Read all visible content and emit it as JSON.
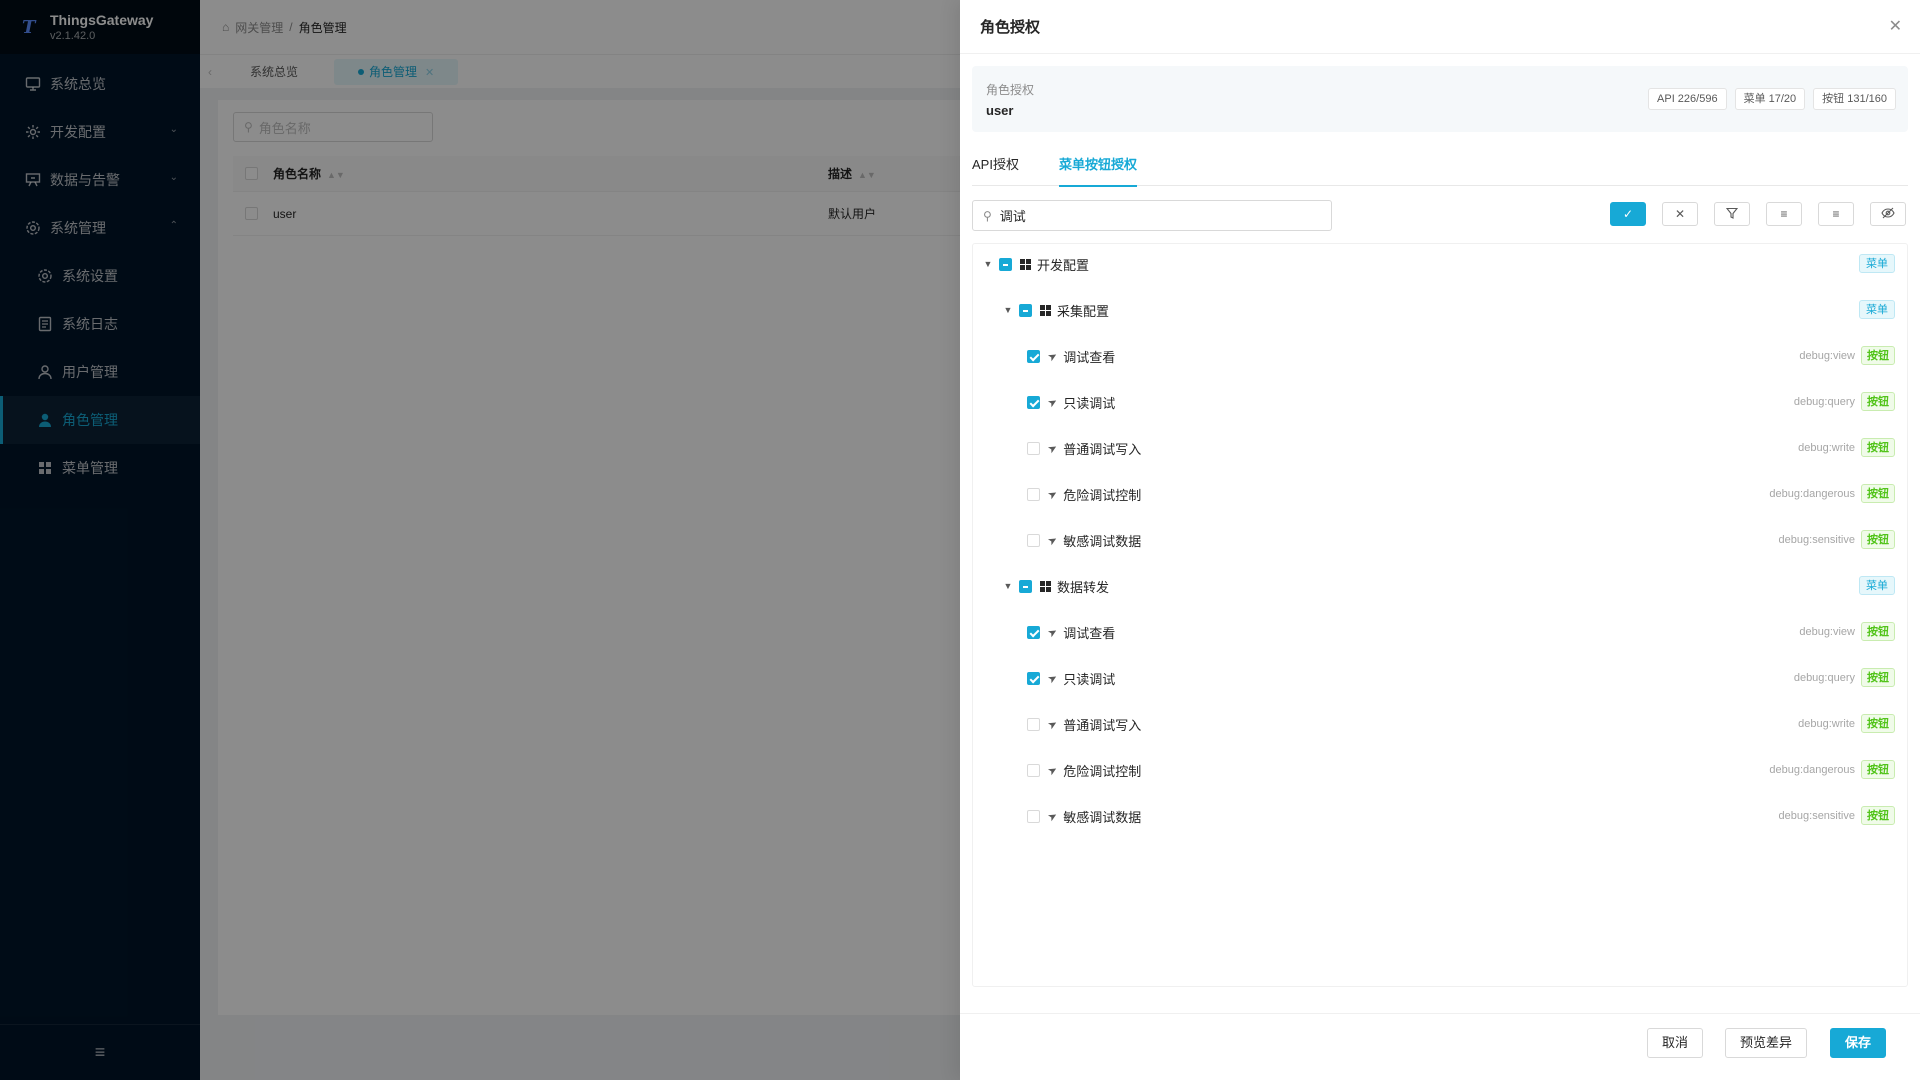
{
  "app": {
    "name": "ThingsGateway",
    "version": "v2.1.42.0"
  },
  "sidebar": {
    "items": [
      {
        "label": "系统总览",
        "icon": "monitor-icon"
      },
      {
        "label": "开发配置",
        "icon": "gear-icon"
      },
      {
        "label": "数据与告警",
        "icon": "projector-icon"
      },
      {
        "label": "系统管理",
        "icon": "settings-icon"
      },
      {
        "label": "系统设置",
        "icon": "settings-icon"
      },
      {
        "label": "系统日志",
        "icon": "document-icon"
      },
      {
        "label": "用户管理",
        "icon": "user-icon"
      },
      {
        "label": "角色管理",
        "icon": "user-filled-icon"
      },
      {
        "label": "菜单管理",
        "icon": "grid-icon"
      }
    ]
  },
  "header": {
    "breadcrumb": [
      "网关管理",
      "角色管理"
    ]
  },
  "tabs": [
    {
      "label": "系统总览"
    },
    {
      "label": "角色管理"
    }
  ],
  "list": {
    "search_placeholder": "角色名称",
    "columns": {
      "name": "角色名称",
      "desc": "描述"
    },
    "rows": [
      {
        "name": "user",
        "desc": "默认用户"
      }
    ]
  },
  "drawer": {
    "title": "角色授权",
    "info_label": "角色授权",
    "role_name": "user",
    "stats": {
      "api": "API 226/596",
      "menu": "菜单 17/20",
      "button": "按钮 131/160"
    },
    "tabs": {
      "api": "API授权",
      "menu_button": "菜单按钮授权"
    },
    "search_value": "调试",
    "badge_menu": "菜单",
    "badge_button": "按钮",
    "tree": [
      {
        "label": "开发配置",
        "type": "menu",
        "state": "indeterminate",
        "level": 0
      },
      {
        "label": "采集配置",
        "type": "menu",
        "state": "indeterminate",
        "level": 1
      },
      {
        "label": "调试查看",
        "type": "button",
        "state": "checked",
        "code": "debug:view",
        "level": 2
      },
      {
        "label": "只读调试",
        "type": "button",
        "state": "checked",
        "code": "debug:query",
        "level": 2
      },
      {
        "label": "普通调试写入",
        "type": "button",
        "state": "unchecked",
        "code": "debug:write",
        "level": 2
      },
      {
        "label": "危险调试控制",
        "type": "button",
        "state": "unchecked",
        "code": "debug:dangerous",
        "level": 2
      },
      {
        "label": "敏感调试数据",
        "type": "button",
        "state": "unchecked",
        "code": "debug:sensitive",
        "level": 2
      },
      {
        "label": "数据转发",
        "type": "menu",
        "state": "indeterminate",
        "level": 1
      },
      {
        "label": "调试查看",
        "type": "button",
        "state": "checked",
        "code": "debug:view",
        "level": 2
      },
      {
        "label": "只读调试",
        "type": "button",
        "state": "checked",
        "code": "debug:query",
        "level": 2
      },
      {
        "label": "普通调试写入",
        "type": "button",
        "state": "unchecked",
        "code": "debug:write",
        "level": 2
      },
      {
        "label": "危险调试控制",
        "type": "button",
        "state": "unchecked",
        "code": "debug:dangerous",
        "level": 2
      },
      {
        "label": "敏感调试数据",
        "type": "button",
        "state": "unchecked",
        "code": "debug:sensitive",
        "level": 2
      }
    ],
    "footer": {
      "cancel": "取消",
      "preview": "预览差异",
      "save": "保存"
    }
  },
  "colors": {
    "accent": "#17a9d6",
    "sidebar_bg": "#001529",
    "button_badge": "#52c41a"
  }
}
